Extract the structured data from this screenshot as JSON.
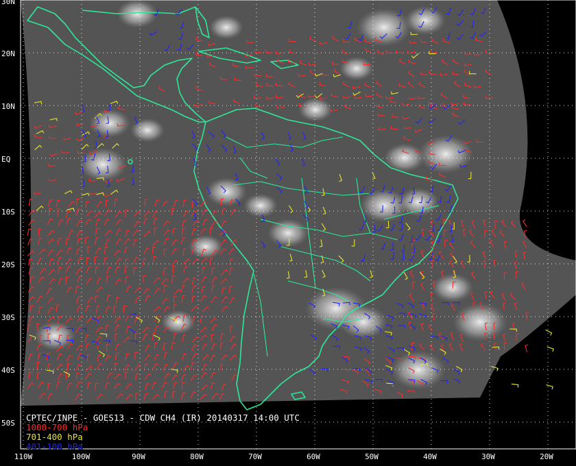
{
  "caption": {
    "title": "CPTEC/INPE - GOES13 - CDW CH4 (IR) 20140317 14:00 UTC",
    "legend": [
      {
        "label": "1000-700 hPa",
        "color": "#ff2a2a"
      },
      {
        "label": "701-400 hPa",
        "color": "#e8e826"
      },
      {
        "label": "401-100 hPa",
        "color": "#2222ff"
      }
    ]
  },
  "axes": {
    "lat_labels": [
      "30N",
      "20N",
      "10N",
      "EQ",
      "10S",
      "20S",
      "30S",
      "40S",
      "50S"
    ],
    "lon_labels": [
      "110W",
      "100W",
      "90W",
      "80W",
      "70W",
      "60W",
      "50W",
      "40W",
      "30W",
      "20W"
    ]
  },
  "colors": {
    "coastline": "#2ee89a",
    "grid": "#ffffff",
    "background": "#000000",
    "low_level": "#ff2a2a",
    "mid_level": "#e8e826",
    "high_level": "#2222ff"
  }
}
